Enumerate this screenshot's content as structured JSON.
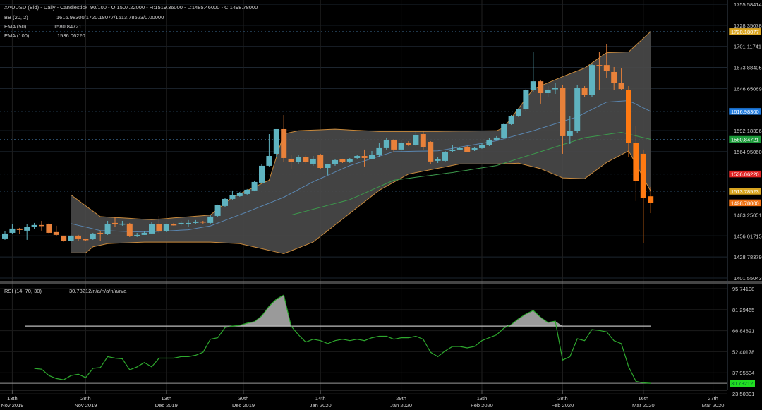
{
  "header": {
    "symbol_line": "XAUUSD (Bid) - Daily - Candlestick",
    "ohlc_line": "90/100 - O:1507.22000 - H:1519.36000 - L:1485.46000 - C:1498.78000",
    "bb_label": "BB (20, 2)",
    "bb_values": "1616.98300/1720.18077/1513.78523/0.00000",
    "ema50_label": "EMA (50)",
    "ema50_value": "1580.84721",
    "ema100_label": "EMA (100)",
    "ema100_value": "1536.06220",
    "rsi_label": "RSI (14, 70, 30)",
    "rsi_values": "30.73212/n/a/n/a/n/a/n/a"
  },
  "colors": {
    "up": "#5fb3c0",
    "down": "#e8813a",
    "band": "#c98a3c",
    "band_fill": "#4a4a4a",
    "middle": "#5a86b0",
    "ema50": "#3c9a4c",
    "rsi": "#2ea82e",
    "tag_gold": "#d9a521",
    "tag_blue": "#1e7be0",
    "tag_green": "#1c9a3a",
    "tag_red": "#e02424",
    "tag_orange": "#f07214",
    "tag_rsi": "#22dd22"
  },
  "chart_data": [
    {
      "type": "candlestick",
      "title": "XAUUSD (Bid) - Daily - Candlestick",
      "ylim": [
        1401.55043,
        1755.58414
      ],
      "y_ticks": [
        "1755.58414",
        "1728.35078",
        "1701.11741",
        "1673.88405",
        "1646.65069",
        "1592.18396",
        "1564.95060",
        "1483.25051",
        "1456.01715",
        "1428.78379",
        "1401.55043"
      ],
      "x_ticks": [
        {
          "idx": 1,
          "day": "13th",
          "month": "Nov 2019"
        },
        {
          "idx": 11,
          "day": "28th",
          "month": "Nov 2019"
        },
        {
          "idx": 22,
          "day": "13th",
          "month": "Dec 2019"
        },
        {
          "idx": 32.5,
          "day": "30th",
          "month": "Dec 2019"
        },
        {
          "idx": 43,
          "day": "14th",
          "month": "Jan 2020"
        },
        {
          "idx": 54,
          "day": "29th",
          "month": "Jan 2020"
        },
        {
          "idx": 65,
          "day": "13th",
          "month": "Feb 2020"
        },
        {
          "idx": 76,
          "day": "28th",
          "month": "Feb 2020"
        },
        {
          "idx": 87,
          "day": "16th",
          "month": "Mar 2020"
        },
        {
          "idx": 96.5,
          "day": "27th",
          "month": "Mar 2020"
        }
      ],
      "price_tags": [
        {
          "value": 1720.18077,
          "label": "1720.18077",
          "color": "tag_gold"
        },
        {
          "value": 1616.983,
          "label": "1616.98300",
          "color": "tag_blue"
        },
        {
          "value": 1580.84721,
          "label": "1580.84721",
          "color": "tag_green"
        },
        {
          "value": 1536.0622,
          "label": "1536.06220",
          "color": "tag_red"
        },
        {
          "value": 1513.78523,
          "label": "1513.78523",
          "color": "tag_gold"
        },
        {
          "value": 1498.78,
          "label": "1498.78000",
          "color": "tag_orange"
        }
      ],
      "ohlc": [
        [
          1452.7,
          1461.9,
          1450.9,
          1459.1
        ],
        [
          1460,
          1471,
          1458.2,
          1465.5
        ],
        [
          1465.5,
          1466.4,
          1458.2,
          1463.7
        ],
        [
          1462.8,
          1471,
          1450.9,
          1467.3
        ],
        [
          1467.3,
          1472.8,
          1464.6,
          1470.1
        ],
        [
          1470.1,
          1475.5,
          1462.8,
          1469.2
        ],
        [
          1471,
          1472.8,
          1458.2,
          1460
        ],
        [
          1461,
          1469.2,
          1455.5,
          1457.3
        ],
        [
          1456.4,
          1456.4,
          1448.2,
          1449.1
        ],
        [
          1449.1,
          1457.3,
          1447.3,
          1456.4
        ],
        [
          1456.4,
          1457.3,
          1449.1,
          1452.7
        ],
        [
          1451.8,
          1452.7,
          1449.1,
          1450.9
        ],
        [
          1451.8,
          1460,
          1450.9,
          1459.1
        ],
        [
          1460,
          1462.8,
          1449.1,
          1458.2
        ],
        [
          1458.2,
          1475.5,
          1457.3,
          1471
        ],
        [
          1472.8,
          1480.1,
          1467.3,
          1471
        ],
        [
          1471,
          1475.5,
          1469.2,
          1471.9
        ],
        [
          1471.9,
          1472.8,
          1454.6,
          1455.5
        ],
        [
          1456.4,
          1460,
          1454.6,
          1457.3
        ],
        [
          1457.3,
          1461.9,
          1457.3,
          1460
        ],
        [
          1459.1,
          1474.6,
          1458.2,
          1471
        ],
        [
          1471,
          1481.9,
          1460,
          1461.9
        ],
        [
          1461.9,
          1471.9,
          1461,
          1471
        ],
        [
          1471,
          1472.8,
          1469.2,
          1470.5
        ],
        [
          1471,
          1475.5,
          1469.2,
          1472.8
        ],
        [
          1471.9,
          1476.5,
          1467.3,
          1472.8
        ],
        [
          1472.8,
          1476.5,
          1471.9,
          1474.6
        ],
        [
          1474.6,
          1475.5,
          1471.9,
          1473.7
        ],
        [
          1472.8,
          1482.8,
          1471.9,
          1481
        ],
        [
          1481.9,
          1496.5,
          1481,
          1495.6
        ],
        [
          1494.7,
          1504.7,
          1492.9,
          1503.8
        ],
        [
          1503.8,
          1514.8,
          1502.9,
          1508.4
        ],
        [
          1507.5,
          1512.9,
          1506.6,
          1512
        ],
        [
          1510.2,
          1516.6,
          1509.3,
          1515.7
        ],
        [
          1514.8,
          1527.5,
          1513.8,
          1525.7
        ],
        [
          1524.8,
          1548.5,
          1523.9,
          1546.7
        ],
        [
          1546.7,
          1587.7,
          1545.8,
          1559.4
        ],
        [
          1562.2,
          1594.1,
          1558.5,
          1594.1
        ],
        [
          1594.1,
          1612.3,
          1551.2,
          1556.7
        ],
        [
          1555.8,
          1560.4,
          1542.1,
          1551.2
        ],
        [
          1551.2,
          1560.4,
          1549.4,
          1558.5
        ],
        [
          1558.5,
          1560.4,
          1549.4,
          1551.2
        ],
        [
          1549.4,
          1559.4,
          1546.7,
          1555.8
        ],
        [
          1560.4,
          1562.2,
          1542.1,
          1543.9
        ],
        [
          1543.9,
          1549.4,
          1534.8,
          1548.5
        ],
        [
          1548.5,
          1554.9,
          1546.7,
          1554
        ],
        [
          1554.9,
          1555.8,
          1550.3,
          1551.2
        ],
        [
          1552.2,
          1556.7,
          1550.3,
          1554.9
        ],
        [
          1556.7,
          1560.4,
          1554.9,
          1559.4
        ],
        [
          1559.4,
          1567.7,
          1545.8,
          1556.7
        ],
        [
          1555.8,
          1565.8,
          1554.9,
          1560.4
        ],
        [
          1560.4,
          1575.9,
          1558.5,
          1569.5
        ],
        [
          1569.5,
          1583.2,
          1567.7,
          1580.4
        ],
        [
          1580.4,
          1581.3,
          1564.9,
          1567.7
        ],
        [
          1567.7,
          1579.5,
          1564.9,
          1575.9
        ],
        [
          1575.9,
          1578.6,
          1572.2,
          1574
        ],
        [
          1574,
          1591.4,
          1572.2,
          1586.8
        ],
        [
          1587.7,
          1592.3,
          1567.7,
          1570.4
        ],
        [
          1577.7,
          1578.6,
          1549.4,
          1552.2
        ],
        [
          1553.1,
          1557.6,
          1550.3,
          1554.9
        ],
        [
          1553.1,
          1565.8,
          1551.2,
          1564
        ],
        [
          1565.8,
          1574,
          1564,
          1567.7
        ],
        [
          1567.7,
          1571.3,
          1566.7,
          1569.5
        ],
        [
          1570.4,
          1572.2,
          1564,
          1564.9
        ],
        [
          1566.7,
          1571.3,
          1565.8,
          1569.5
        ],
        [
          1569.5,
          1575.9,
          1568.6,
          1574
        ],
        [
          1574,
          1582.2,
          1572.2,
          1580.4
        ],
        [
          1580.4,
          1585,
          1579.5,
          1583.2
        ],
        [
          1582.2,
          1602.3,
          1581.3,
          1600.5
        ],
        [
          1600.5,
          1612.3,
          1599.6,
          1610.5
        ],
        [
          1610.5,
          1620.5,
          1609.6,
          1619.6
        ],
        [
          1619.6,
          1646,
          1617.8,
          1644.3
        ],
        [
          1644.3,
          1693.5,
          1642.4,
          1656
        ],
        [
          1656,
          1658,
          1627,
          1640.6
        ],
        [
          1640.6,
          1649.7,
          1636,
          1645.2
        ],
        [
          1646,
          1653.4,
          1639.7,
          1647
        ],
        [
          1647,
          1651.6,
          1562.2,
          1585
        ],
        [
          1585,
          1610.5,
          1574.9,
          1591.4
        ],
        [
          1591.4,
          1651.6,
          1589.5,
          1647
        ],
        [
          1647,
          1649.7,
          1636,
          1637.9
        ],
        [
          1637.9,
          1678,
          1635.1,
          1677
        ],
        [
          1677,
          1694.4,
          1644.3,
          1675.3
        ],
        [
          1677,
          1704.5,
          1660.7,
          1668.9
        ],
        [
          1668,
          1674.4,
          1644.3,
          1653.4
        ],
        [
          1653.4,
          1672.5,
          1644.3,
          1646
        ],
        [
          1645.2,
          1649.7,
          1558.5,
          1575.9
        ],
        [
          1575.9,
          1598.7,
          1501.1,
          1526.6
        ],
        [
          1562.2,
          1567.7,
          1446.4,
          1504.7
        ],
        [
          1507.22,
          1519.36,
          1485.46,
          1498.78
        ]
      ],
      "bb_upper": [
        [
          9,
          1509
        ],
        [
          13,
          1481
        ],
        [
          20,
          1477
        ],
        [
          28,
          1483
        ],
        [
          31,
          1506
        ],
        [
          36,
          1528
        ],
        [
          38,
          1588
        ],
        [
          40,
          1592
        ],
        [
          45,
          1594
        ],
        [
          51,
          1591
        ],
        [
          57,
          1591
        ],
        [
          67,
          1592
        ],
        [
          68,
          1596
        ],
        [
          72,
          1646
        ],
        [
          76,
          1662
        ],
        [
          79,
          1673
        ],
        [
          82,
          1693
        ],
        [
          85,
          1694
        ],
        [
          88,
          1720.18
        ]
      ],
      "bb_middle": [
        [
          9,
          1472
        ],
        [
          13,
          1463
        ],
        [
          19,
          1461
        ],
        [
          25,
          1464
        ],
        [
          28,
          1469
        ],
        [
          33,
          1487
        ],
        [
          38,
          1506
        ],
        [
          42,
          1526
        ],
        [
          47,
          1547
        ],
        [
          53,
          1565
        ],
        [
          59,
          1566
        ],
        [
          67,
          1579
        ],
        [
          72,
          1592
        ],
        [
          78,
          1610
        ],
        [
          82,
          1629
        ],
        [
          85,
          1631
        ],
        [
          88,
          1616.98
        ]
      ],
      "bb_lower": [
        [
          9,
          1434
        ],
        [
          11,
          1434
        ],
        [
          12,
          1442
        ],
        [
          14,
          1446
        ],
        [
          19,
          1448
        ],
        [
          28,
          1448
        ],
        [
          32,
          1446
        ],
        [
          38,
          1433
        ],
        [
          42,
          1448
        ],
        [
          51,
          1515
        ],
        [
          55,
          1536
        ],
        [
          62,
          1549
        ],
        [
          67,
          1549
        ],
        [
          70,
          1550
        ],
        [
          73,
          1543
        ],
        [
          76,
          1531
        ],
        [
          79,
          1530
        ],
        [
          82,
          1551
        ],
        [
          85,
          1566
        ],
        [
          88,
          1513.79
        ]
      ],
      "ema50": [
        [
          39,
          1483
        ],
        [
          47,
          1503
        ],
        [
          53,
          1528
        ],
        [
          61,
          1538
        ],
        [
          67,
          1547
        ],
        [
          73,
          1565
        ],
        [
          79,
          1583
        ],
        [
          84,
          1590
        ],
        [
          88,
          1580.85
        ]
      ]
    },
    {
      "type": "line",
      "title": "RSI (14, 70, 30)",
      "ylim": [
        23.50891,
        95.74108
      ],
      "level": 70,
      "y_ticks": [
        "95.74108",
        "81.29465",
        "66.84821",
        "52.40178",
        "37.95534",
        "23.50891"
      ],
      "current_label": "30.73212",
      "points": [
        [
          4,
          40.9
        ],
        [
          5,
          40.4
        ],
        [
          6,
          36
        ],
        [
          7,
          34
        ],
        [
          8,
          33.1
        ],
        [
          9,
          36
        ],
        [
          10,
          37
        ],
        [
          11,
          34.6
        ],
        [
          12,
          41
        ],
        [
          13,
          41.5
        ],
        [
          14,
          49
        ],
        [
          15,
          48
        ],
        [
          16,
          47.5
        ],
        [
          17,
          40
        ],
        [
          18,
          42
        ],
        [
          19,
          45
        ],
        [
          20,
          42
        ],
        [
          21,
          48
        ],
        [
          22,
          48
        ],
        [
          23,
          48
        ],
        [
          24,
          49
        ],
        [
          25,
          49
        ],
        [
          26,
          50
        ],
        [
          27,
          52
        ],
        [
          28,
          61
        ],
        [
          29,
          62
        ],
        [
          30,
          69
        ],
        [
          31,
          70
        ],
        [
          32,
          70.5
        ],
        [
          33,
          72
        ],
        [
          34,
          73
        ],
        [
          35,
          77
        ],
        [
          36,
          83.6
        ],
        [
          37,
          88.5
        ],
        [
          38,
          91.3
        ],
        [
          39,
          70
        ],
        [
          40,
          64
        ],
        [
          41,
          59
        ],
        [
          42,
          61
        ],
        [
          43,
          60
        ],
        [
          44,
          58
        ],
        [
          45,
          60
        ],
        [
          46,
          61
        ],
        [
          47,
          60
        ],
        [
          48,
          61
        ],
        [
          49,
          60
        ],
        [
          50,
          62
        ],
        [
          51,
          63
        ],
        [
          52,
          63
        ],
        [
          53,
          61
        ],
        [
          54,
          62
        ],
        [
          55,
          62
        ],
        [
          56,
          63
        ],
        [
          57,
          61
        ],
        [
          58,
          52
        ],
        [
          59,
          49
        ],
        [
          60,
          53
        ],
        [
          61,
          56
        ],
        [
          62,
          56
        ],
        [
          63,
          55
        ],
        [
          64,
          56
        ],
        [
          65,
          60
        ],
        [
          66,
          62
        ],
        [
          67,
          64
        ],
        [
          68,
          68.6
        ],
        [
          69,
          71
        ],
        [
          70,
          75
        ],
        [
          71,
          78.3
        ],
        [
          72,
          80.7
        ],
        [
          73,
          76
        ],
        [
          74,
          72.4
        ],
        [
          75,
          73.4
        ],
        [
          76,
          46.7
        ],
        [
          77,
          49
        ],
        [
          78,
          61.3
        ],
        [
          79,
          60
        ],
        [
          80,
          67.6
        ],
        [
          81,
          67
        ],
        [
          82,
          66
        ],
        [
          83,
          60
        ],
        [
          84,
          58
        ],
        [
          85,
          42
        ],
        [
          86,
          32
        ],
        [
          87,
          31
        ],
        [
          88,
          30.73
        ]
      ]
    }
  ]
}
